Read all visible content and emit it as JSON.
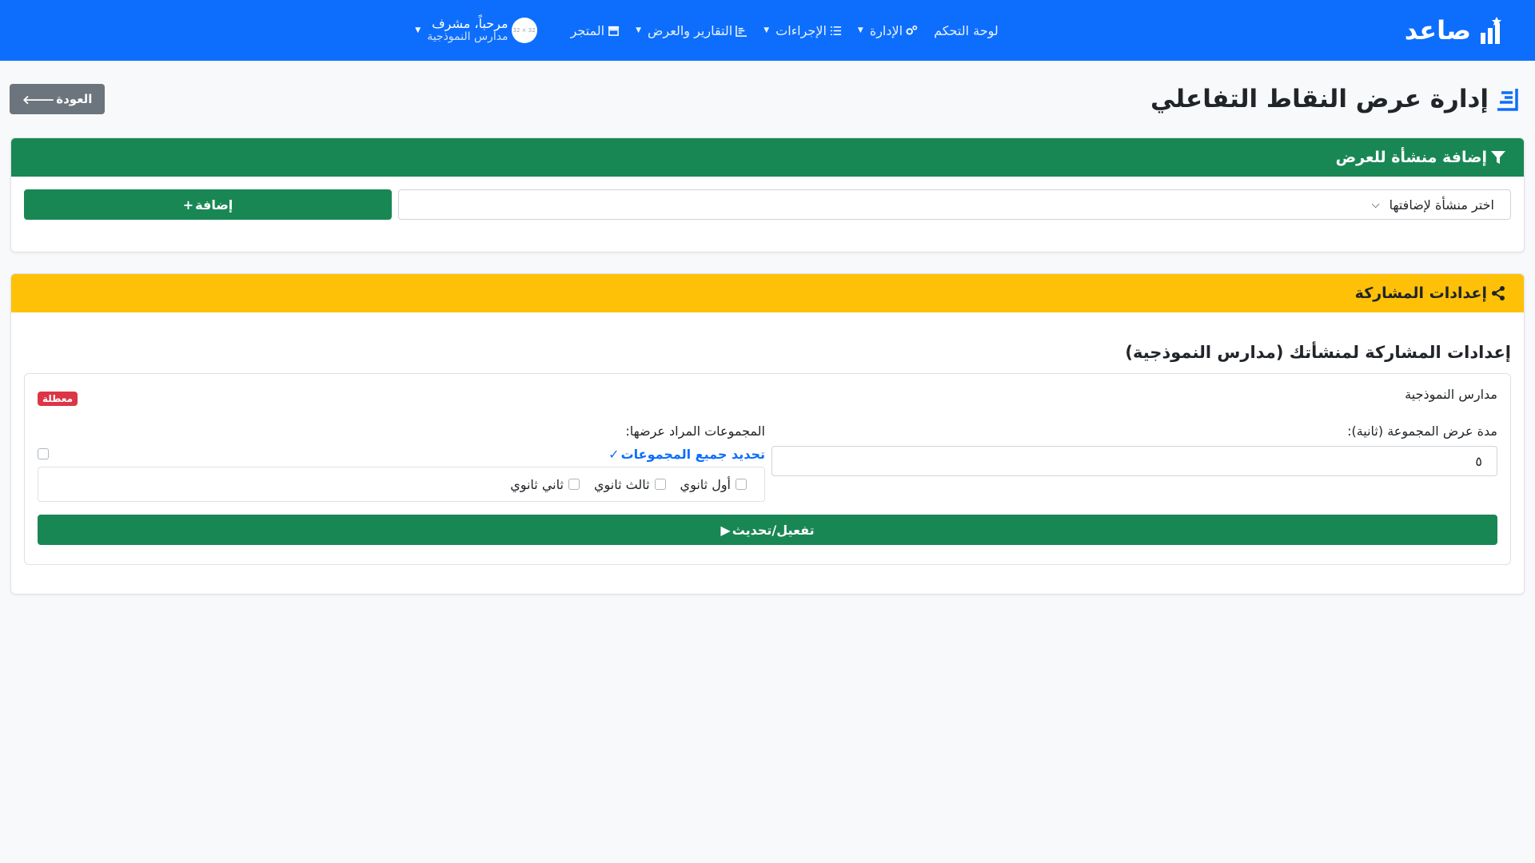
{
  "navbar": {
    "brand": "صاعد",
    "items": [
      {
        "label": "لوحة التحكم",
        "icon": "none",
        "has_caret": false
      },
      {
        "label": "الإدارة",
        "icon": "gears-icon",
        "has_caret": true
      },
      {
        "label": "الإجراءات",
        "icon": "tasks-icon",
        "has_caret": true
      },
      {
        "label": "التقارير والعرض",
        "icon": "chart-icon",
        "has_caret": true
      },
      {
        "label": "المتجر",
        "icon": "store-icon",
        "has_caret": false
      }
    ],
    "user": {
      "avatar_text": "32 × 32",
      "greeting": "مرحباً، مشرف",
      "org": "مدارس النموذجية"
    }
  },
  "page": {
    "title": "إدارة عرض النقاط التفاعلي",
    "back_label": "العودة"
  },
  "add_card": {
    "header": "إضافة منشأة للعرض",
    "select_placeholder": "اختر منشأة لإضافتها",
    "add_label": "إضافة"
  },
  "share_card": {
    "header": "إعدادات المشاركة",
    "subtitle": "إعدادات المشاركة لمنشأتك (مدارس النموذجية)",
    "org_name": "مدارس النموذجية",
    "status_badge": "معطلة",
    "duration_label": "مدة عرض المجموعة (ثانية):",
    "duration_value": "٥",
    "groups_label": "المجموعات المراد عرضها:",
    "select_all_label": "تحديد جميع المجموعات",
    "groups": [
      "أول ثانوي",
      "ثالث ثانوي",
      "ثاني ثانوي"
    ],
    "activate_label": "تفعيل/تحديث"
  },
  "colors": {
    "navbar": "#0d6efd",
    "green": "#198754",
    "yellow": "#ffc107",
    "danger": "#dc3545",
    "secondary": "#6c757d"
  }
}
